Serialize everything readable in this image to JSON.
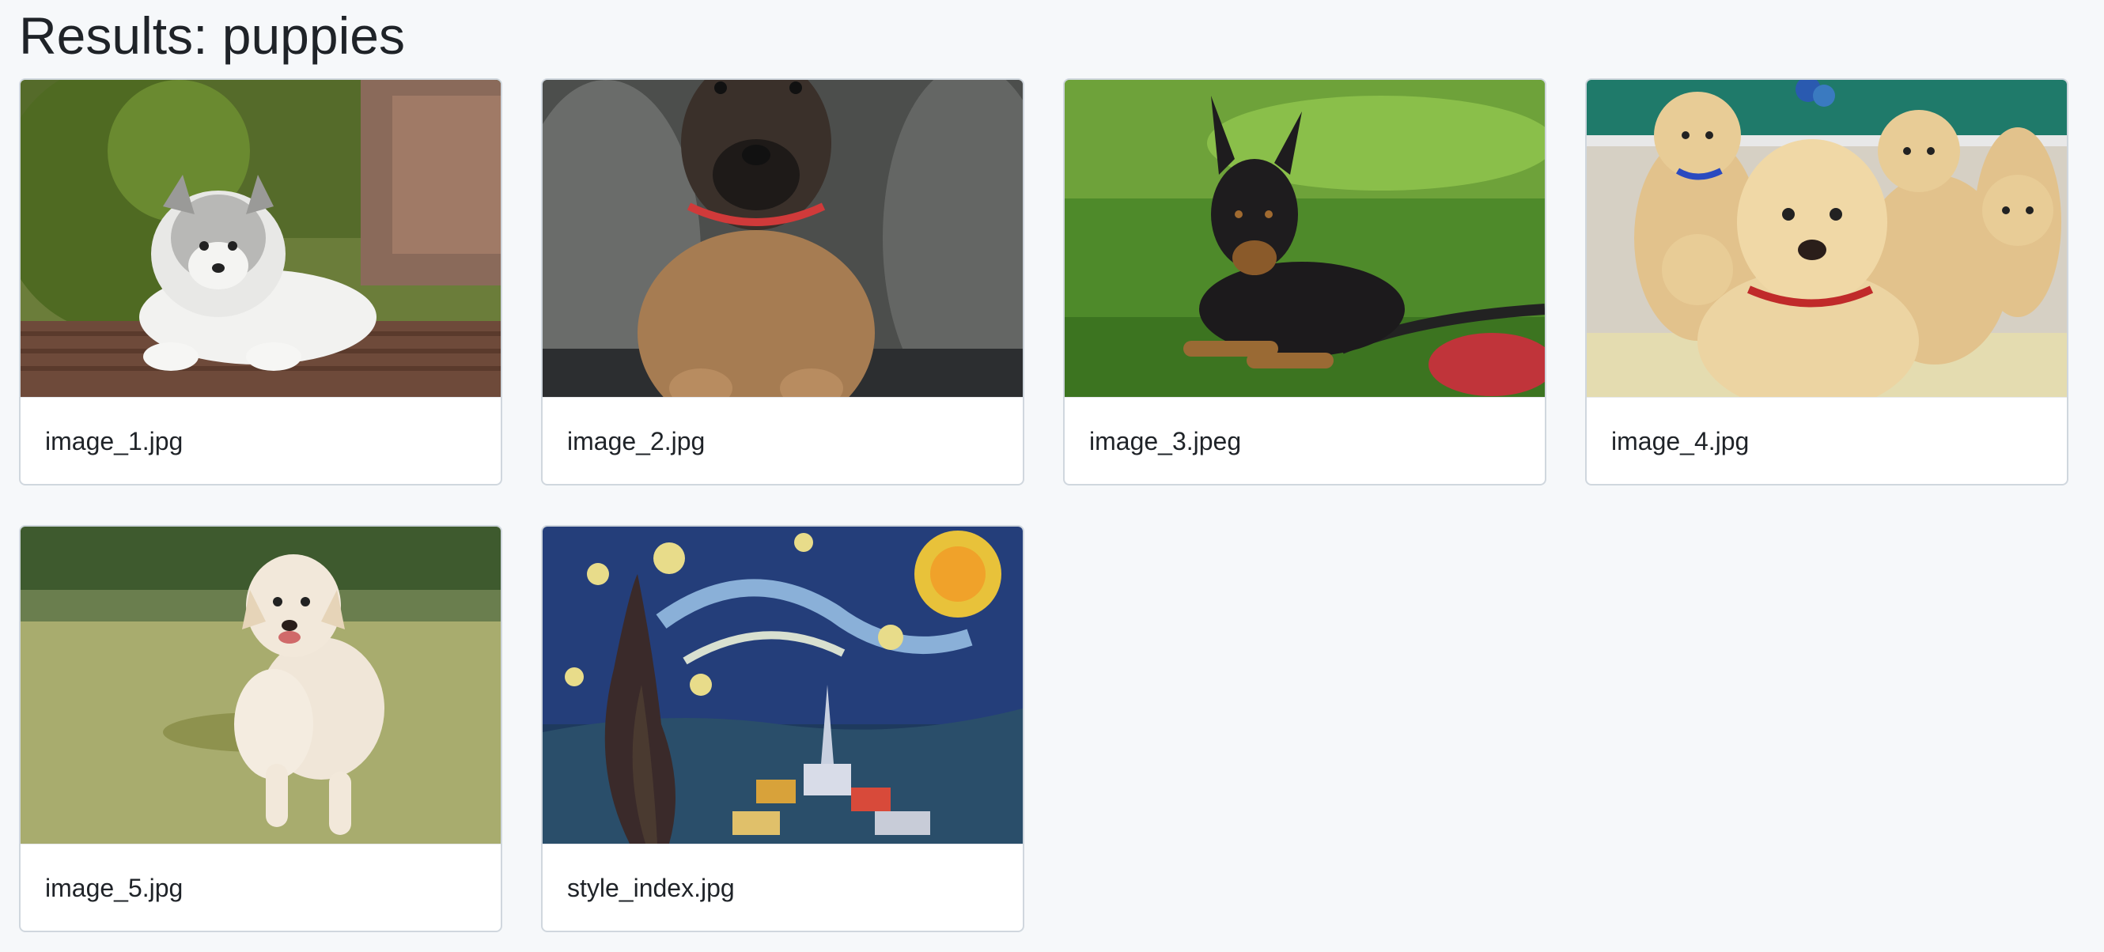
{
  "page": {
    "title": "Results: puppies"
  },
  "results": [
    {
      "filename": "image_1.jpg",
      "thumbnail_icon": "fluffy-puppy-on-deck-photo"
    },
    {
      "filename": "image_2.jpg",
      "thumbnail_icon": "shepherd-puppy-on-couch-photo"
    },
    {
      "filename": "image_3.jpeg",
      "thumbnail_icon": "doberman-puppy-on-grass-photo"
    },
    {
      "filename": "image_4.jpg",
      "thumbnail_icon": "labrador-puppies-group-photo"
    },
    {
      "filename": "image_5.jpg",
      "thumbnail_icon": "puppy-running-on-grass-photo"
    },
    {
      "filename": "style_index.jpg",
      "thumbnail_icon": "starry-night-painting"
    }
  ],
  "colors": {
    "background": "#f6f8fa",
    "card_border": "#d0d7de",
    "text": "#1f2328"
  }
}
